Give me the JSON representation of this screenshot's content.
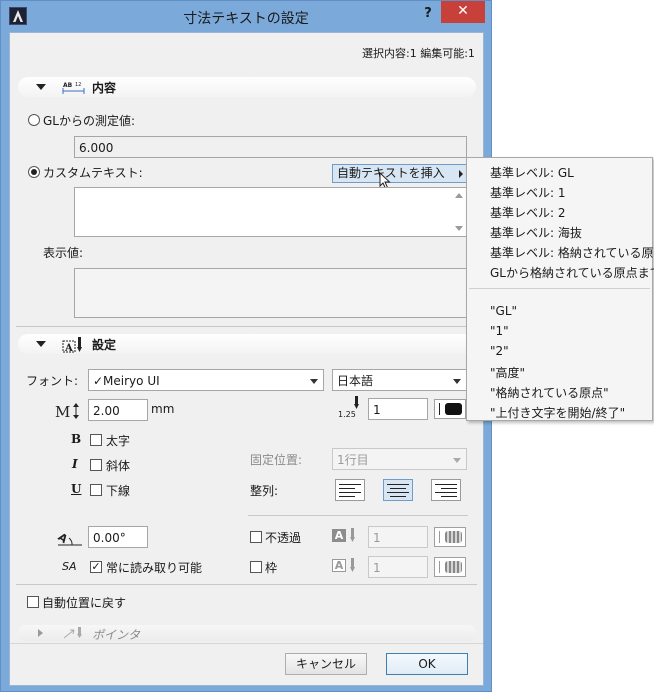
{
  "window": {
    "title": "寸法テキストの設定",
    "help_label": "?",
    "close_label": "✕"
  },
  "status": "選択内容:1 編集可能:1",
  "content_panel": {
    "title": "内容",
    "icon": "dimension-text-icon",
    "gl_radio_label": "GLからの測定値:",
    "gl_value": "6.000",
    "custom_radio_label": "カスタムテキスト:",
    "insert_auto_text_label": "自動テキストを挿入",
    "custom_text_value": "",
    "display_value_label": "表示値:",
    "display_value": ""
  },
  "settings_panel": {
    "title": "設定",
    "icon": "text-settings-icon",
    "font_label": "フォント:",
    "font_value": "✓Meiryo UI",
    "script_value": "日本語",
    "size_value": "2.00",
    "size_unit": "mm",
    "pen_label": "1.25",
    "pen_value": "1",
    "bold_label": "太字",
    "italic_label": "斜体",
    "underline_label": "下線",
    "bold_glyph": "B",
    "italic_glyph": "I",
    "underline_glyph": "U",
    "anchor_label": "固定位置:",
    "anchor_value": "1行目",
    "align_label": "整列:",
    "angle_value": "0.00°",
    "opaque_label": "不透過",
    "opaque_pen": "1",
    "frame_label": "枠",
    "frame_pen": "1",
    "readable_label": "常に読み取り可能",
    "readable_checked": "✓",
    "glyph_a": "A",
    "glyph_sa": "SA"
  },
  "reset_position_label": "自動位置に戻す",
  "pointer_panel": {
    "title": "ポインタ"
  },
  "buttons": {
    "cancel": "キャンセル",
    "ok": "OK"
  },
  "auto_text_menu": {
    "group1": [
      "基準レベル: GL",
      "基準レベル: 1",
      "基準レベル: 2",
      "基準レベル: 海抜",
      "基準レベル: 格納されている原点",
      "GLから格納されている原点まで"
    ],
    "group2": [
      "\"GL\"",
      "\"1\"",
      "\"2\"",
      "\"高度\"",
      "\"格納されている原点\"",
      "\"上付き文字を開始/終了\""
    ]
  },
  "colors": {
    "titlebar": "#7aa9da",
    "close_button": "#c7403a",
    "dialog_bg": "#f0f0f0",
    "highlight": "#d8e6f4"
  }
}
